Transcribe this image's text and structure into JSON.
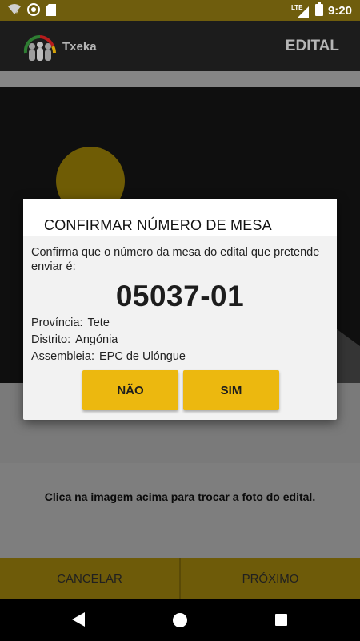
{
  "status_bar": {
    "time": "9:20",
    "network_label": "LTE",
    "icons": [
      "wifi-icon",
      "media-icon",
      "sd-card-icon",
      "lte-signal-icon",
      "battery-icon"
    ]
  },
  "app_bar": {
    "logo_text": "Txeka",
    "screen_title": "EDITAL"
  },
  "main": {
    "hint": "Clica na imagem acima para trocar a foto do edital."
  },
  "bottom_actions": {
    "cancel_label": "CANCELAR",
    "next_label": "PRÓXIMO"
  },
  "dialog": {
    "title": "CONFIRMAR NÚMERO DE MESA",
    "message": "Confirma que o número da mesa do edital que pretende enviar é:",
    "number": "05037-01",
    "province_label": "Província:",
    "province_value": "Tete",
    "district_label": "Distrito:",
    "district_value": "Angónia",
    "assembly_label": "Assembleia:",
    "assembly_value": "EPC de Ulóngue",
    "no_label": "NÃO",
    "yes_label": "SIM"
  },
  "colors": {
    "accent": "#ecb80f",
    "appbar": "#1c1c1c",
    "dim_overlay_statusbar": "#6f5d0d"
  },
  "nav_bar": {
    "icons": [
      "back-icon",
      "home-icon",
      "recent-apps-icon"
    ]
  }
}
